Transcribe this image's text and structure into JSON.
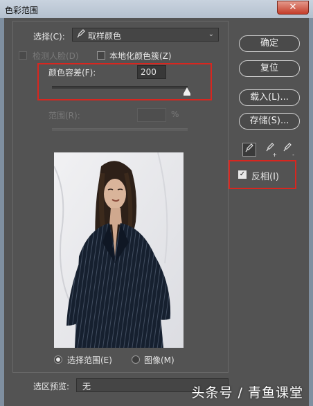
{
  "window": {
    "title": "色彩范围",
    "close_glyph": "✕"
  },
  "select": {
    "label": "选择(C):",
    "value": "取样颜色",
    "icon": "eyedropper-icon"
  },
  "options": {
    "detect_faces_label": "检测人脸(D)",
    "detect_faces_checked": false,
    "localized_clusters_label": "本地化颜色簇(Z)",
    "localized_clusters_checked": false
  },
  "fuzziness": {
    "label": "颜色容差(F):",
    "value": "200",
    "level_fraction": 1.0
  },
  "range": {
    "label": "范围(R):",
    "value": "",
    "unit": "%"
  },
  "buttons": {
    "ok": "确定",
    "reset": "复位",
    "load": "载入(L)...",
    "save": "存储(S)..."
  },
  "tools": [
    {
      "icon": "eyedropper-icon",
      "active": true
    },
    {
      "icon": "eyedropper-plus-icon",
      "active": false,
      "glyph": "+"
    },
    {
      "icon": "eyedropper-minus-icon",
      "active": false,
      "glyph": "-"
    }
  ],
  "invert": {
    "label": "反相(I)",
    "checked": true
  },
  "view_mode": {
    "selection_label": "选择范围(E)",
    "image_label": "图像(M)",
    "selected": "selection"
  },
  "selection_preview": {
    "label": "选区预览:",
    "value": "无"
  },
  "watermark": "头条号 / 青鱼课堂",
  "colors": {
    "highlight_box": "#d8261f",
    "dialog_bg": "#535353",
    "title_bar": "#c9d3df"
  }
}
